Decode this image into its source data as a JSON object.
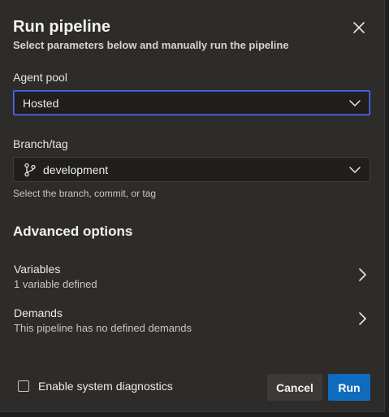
{
  "dialog": {
    "title": "Run pipeline",
    "subtitle": "Select parameters below and manually run the pipeline",
    "close_icon": "close-icon"
  },
  "agent_pool": {
    "label": "Agent pool",
    "value": "Hosted",
    "chevron_icon": "chevron-down-icon"
  },
  "branch": {
    "label": "Branch/tag",
    "value": "development",
    "icon": "branch-icon",
    "helper": "Select the branch, commit, or tag",
    "chevron_icon": "chevron-down-icon"
  },
  "advanced": {
    "title": "Advanced options",
    "items": [
      {
        "title": "Variables",
        "description": "1 variable defined",
        "icon": "chevron-right-icon"
      },
      {
        "title": "Demands",
        "description": "This pipeline has no defined demands",
        "icon": "chevron-right-icon"
      }
    ]
  },
  "footer": {
    "diagnostics_label": "Enable system diagnostics",
    "diagnostics_checked": false,
    "cancel_label": "Cancel",
    "run_label": "Run"
  },
  "colors": {
    "panel_bg": "#2d2c2b",
    "input_bg": "#201f1e",
    "focus_border": "#4f6bed",
    "primary": "#0f6cbd",
    "secondary_button": "#3b3a39"
  }
}
